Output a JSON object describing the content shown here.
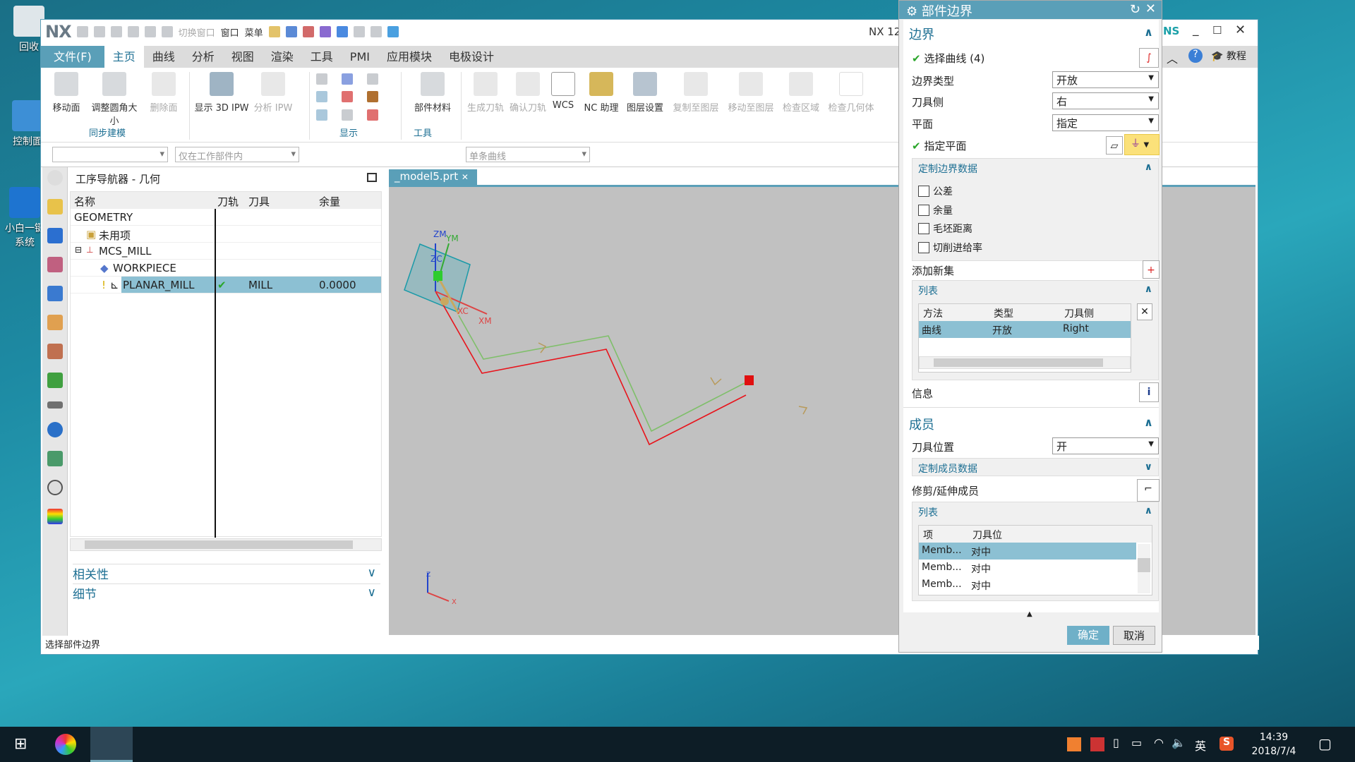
{
  "desktop": {
    "icons": [
      {
        "label": "回收"
      },
      {
        "label": "控制面"
      },
      {
        "label": "小白一键",
        "label2": "系统"
      }
    ]
  },
  "window": {
    "logo": "NX",
    "title": "NX 12",
    "brand_partial": "NS",
    "tutorial": "教程",
    "quick_access": {
      "switch_window": "切换窗口",
      "window": "窗口",
      "menu": "菜单"
    },
    "tabs": [
      "文件(F)",
      "主页",
      "曲线",
      "分析",
      "视图",
      "渲染",
      "工具",
      "PMI",
      "应用模块",
      "电极设计"
    ],
    "active_tab": "主页",
    "ribbon": {
      "buttons": [
        {
          "label": "移动面",
          "enabled": true
        },
        {
          "label": "调整圆角大小",
          "enabled": true
        },
        {
          "label": "删除面",
          "enabled": false
        },
        {
          "label": "显示 3D IPW",
          "enabled": true
        },
        {
          "label": "分析 IPW",
          "enabled": false
        },
        {
          "label": "部件材料",
          "enabled": true
        },
        {
          "label": "生成刀轨",
          "enabled": false
        },
        {
          "label": "确认刀轨",
          "enabled": false
        },
        {
          "label": "WCS",
          "enabled": true
        },
        {
          "label": "NC 助理",
          "enabled": true
        },
        {
          "label": "图层设置",
          "enabled": true
        },
        {
          "label": "复制至图层",
          "enabled": false
        },
        {
          "label": "移动至图层",
          "enabled": false
        },
        {
          "label": "检查区域",
          "enabled": false
        },
        {
          "label": "检查几何体",
          "enabled": false
        }
      ],
      "groups": [
        "同步建模",
        "显示",
        "工具"
      ]
    },
    "selection_bar": {
      "filter": "",
      "scope": "仅在工作部件内",
      "curve_rule": "单条曲线"
    },
    "navigator": {
      "title": "工序导航器 - 几何",
      "columns": [
        "名称",
        "刀轨",
        "刀具",
        "余量"
      ],
      "rows": [
        {
          "name": "GEOMETRY",
          "path": "",
          "tool": "",
          "stock": ""
        },
        {
          "name": "未用项",
          "path": "",
          "tool": "",
          "stock": ""
        },
        {
          "name": "MCS_MILL",
          "path": "",
          "tool": "",
          "stock": ""
        },
        {
          "name": "WORKPIECE",
          "path": "",
          "tool": "",
          "stock": ""
        },
        {
          "name": "PLANAR_MILL",
          "path": "✔",
          "tool": "MILL",
          "stock": "0.0000"
        }
      ],
      "panels": [
        "相关性",
        "细节"
      ]
    },
    "viewport": {
      "tab": "_model5.prt",
      "axis_labels": {
        "zm": "ZM",
        "ym": "YM",
        "zc": "ZC",
        "xc": "XC",
        "xm": "XM",
        "x": "X",
        "z": "Z"
      }
    },
    "status": "选择部件边界"
  },
  "dialog": {
    "title": "部件边界",
    "boundary": {
      "header": "边界",
      "select_curve": "选择曲线 (4)",
      "boundary_type_label": "边界类型",
      "boundary_type": "开放",
      "tool_side_label": "刀具侧",
      "tool_side": "右",
      "plane_label": "平面",
      "plane": "指定",
      "specify_plane": "指定平面"
    },
    "custom_boundary": {
      "header": "定制边界数据",
      "checkboxes": [
        {
          "label": "公差",
          "checked": false
        },
        {
          "label": "余量",
          "checked": false
        },
        {
          "label": "毛坯距离",
          "checked": false
        },
        {
          "label": "切削进给率",
          "checked": false
        }
      ]
    },
    "add_set": "添加新集",
    "list1": {
      "header": "列表",
      "columns": [
        "方法",
        "类型",
        "刀具侧"
      ],
      "rows": [
        [
          "曲线",
          "开放",
          "Right"
        ]
      ]
    },
    "info": "信息",
    "members": {
      "header": "成员",
      "tool_position_label": "刀具位置",
      "tool_position": "开",
      "custom_member": "定制成员数据",
      "trim_extend": "修剪/延伸成员"
    },
    "list2": {
      "header": "列表",
      "columns": [
        "项",
        "刀具位"
      ],
      "rows": [
        [
          "Memb...",
          "对中"
        ],
        [
          "Memb...",
          "对中"
        ],
        [
          "Memb...",
          "对中"
        ]
      ]
    },
    "ok": "确定",
    "cancel": "取消"
  },
  "taskbar": {
    "time": "14:39",
    "date": "2018/7/4",
    "ime": "英"
  },
  "colors": {
    "accent": "#5a9fb8",
    "selection": "#8cc0d3",
    "boundary_red": "#e8141c",
    "path_green": "#7fbf6a"
  }
}
